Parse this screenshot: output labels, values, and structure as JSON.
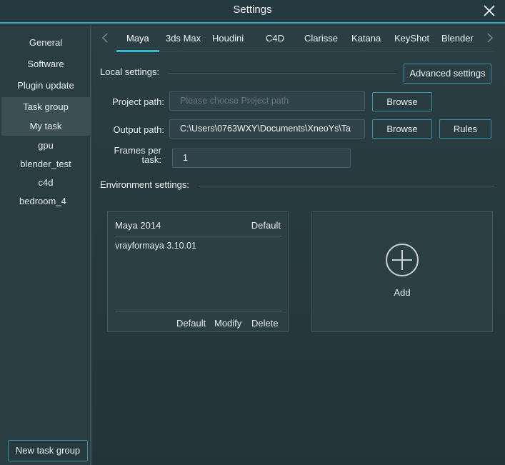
{
  "window": {
    "title": "Settings"
  },
  "sidebar": {
    "items": [
      {
        "label": "General"
      },
      {
        "label": "Software"
      },
      {
        "label": "Plugin update"
      },
      {
        "label": "Task group"
      },
      {
        "label": "My task"
      },
      {
        "label": "gpu"
      },
      {
        "label": "blender_test"
      },
      {
        "label": "c4d"
      },
      {
        "label": "bedroom_4"
      }
    ],
    "new_group_label": "New task group"
  },
  "tabs": [
    {
      "label": "Maya"
    },
    {
      "label": "3ds Max"
    },
    {
      "label": "Houdini"
    },
    {
      "label": "C4D"
    },
    {
      "label": "Clarisse"
    },
    {
      "label": "Katana"
    },
    {
      "label": "KeyShot"
    },
    {
      "label": "Blender"
    }
  ],
  "local": {
    "heading": "Local settings:",
    "advanced_label": "Advanced settings",
    "project_path_label": "Project path:",
    "project_path_value": "",
    "project_path_placeholder": "Please choose Project path",
    "browse_label": "Browse",
    "output_path_label": "Output path:",
    "output_path_value": "C:\\Users\\0763WXY\\Documents\\XneoYs\\Ta",
    "rules_label": "Rules",
    "frames_label": "Frames per task:",
    "frames_value": "1"
  },
  "environment": {
    "heading": "Environment settings:",
    "card": {
      "software": "Maya 2014",
      "default_badge": "Default",
      "plugin": "vrayformaya 3.10.01",
      "actions": {
        "default": "Default",
        "modify": "Modify",
        "delete": "Delete"
      }
    },
    "add_label": "Add"
  },
  "colors": {
    "accent": "#3ab7cf",
    "button_border": "#3b8fa6",
    "background": "#263a40"
  },
  "icons": {
    "close": "close-icon",
    "prev": "chevron-left-icon",
    "next": "chevron-right-icon",
    "add": "plus-circle-icon"
  }
}
